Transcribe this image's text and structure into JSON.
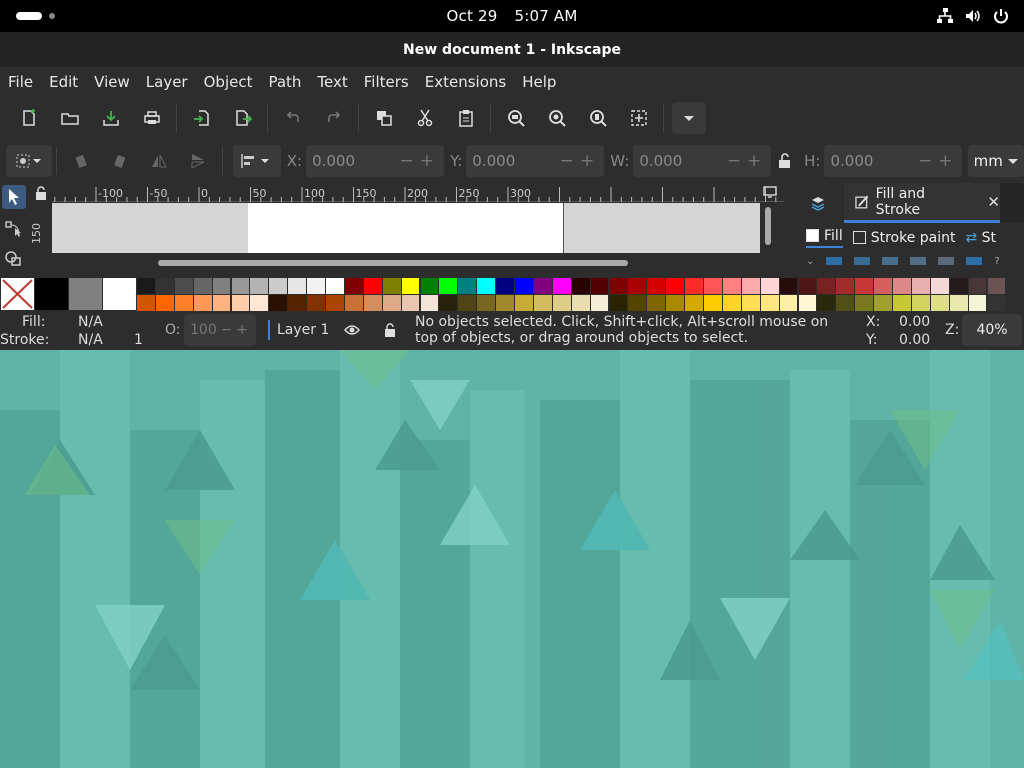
{
  "topbar": {
    "date": "Oct 29",
    "time": "5:07 AM"
  },
  "window": {
    "title": "New document 1 - Inkscape"
  },
  "menu": [
    "File",
    "Edit",
    "View",
    "Layer",
    "Object",
    "Path",
    "Text",
    "Filters",
    "Extensions",
    "Help"
  ],
  "commands": [
    "new-document-icon",
    "open-icon",
    "save-icon",
    "print-icon",
    "import-icon",
    "export-icon",
    "undo-icon",
    "redo-icon",
    "copy-icon",
    "cut-icon",
    "paste-icon",
    "zoom-selection-icon",
    "zoom-drawing-icon",
    "zoom-page-icon",
    "zoom-center-icon",
    "more-icon"
  ],
  "tool_controls": {
    "x_label": "X:",
    "x_value": "0.000",
    "y_label": "Y:",
    "y_value": "0.000",
    "w_label": "W:",
    "w_value": "0.000",
    "h_label": "H:",
    "h_value": "0.000",
    "unit": "mm"
  },
  "ruler": {
    "top_labels": [
      "-100",
      "-50",
      "0",
      "50",
      "100",
      "150",
      "200",
      "250",
      "300"
    ],
    "left_label": "150"
  },
  "dock": {
    "tab_title": "Fill and Stroke",
    "fill_tab": "Fill",
    "stroke_paint_tab": "Stroke paint",
    "stroke_style_tab": "St"
  },
  "palette": {
    "row1": [
      "#1a1a1a",
      "#333333",
      "#4d4d4d",
      "#666666",
      "#808080",
      "#999999",
      "#b3b3b3",
      "#cccccc",
      "#e6e6e6",
      "#f2f2f2",
      "#ffffff",
      "#800000",
      "#ff0000",
      "#808000",
      "#ffff00",
      "#008000",
      "#00ff00",
      "#008080",
      "#00ffff",
      "#000080",
      "#0000ff",
      "#800080",
      "#ff00ff",
      "#2b0000",
      "#550000",
      "#800000",
      "#aa0000",
      "#d40000",
      "#ff0000",
      "#ff2a2a",
      "#ff5555",
      "#ff8080",
      "#ffaaaa",
      "#ffd5d5",
      "#280b0b",
      "#501616",
      "#782121",
      "#a02c2c",
      "#c83737",
      "#d35f5f",
      "#de8787",
      "#e9afaf",
      "#f4d7d7",
      "#241c1c",
      "#483737",
      "#6c5353",
      "#917c6f",
      "#ac9393"
    ],
    "row2": [
      "#d45500",
      "#ff6600",
      "#ff7f2a",
      "#ff9955",
      "#ffb380",
      "#ffccaa",
      "#ffe6d5",
      "#2b1100",
      "#552200",
      "#803300",
      "#aa4400",
      "#c87137",
      "#d38d5f",
      "#deaa87",
      "#e9c6af",
      "#f4e3d7",
      "#28220b",
      "#504416",
      "#786721",
      "#a0892c",
      "#c8ab37",
      "#d3bc5f",
      "#decd87",
      "#e9ddaf",
      "#f4eed7",
      "#2b2200",
      "#554400",
      "#806600",
      "#aa8800",
      "#d4aa00",
      "#ffcc00",
      "#ffd42a",
      "#ffdd55",
      "#ffe680",
      "#ffeeaa",
      "#fff6d5",
      "#282a0b",
      "#505016",
      "#787821",
      "#a0a02c",
      "#c8c837",
      "#d3d35f",
      "#dede87",
      "#e9e9af",
      "#f4f4d7",
      "#333333",
      "#4d4d4d",
      "#666666",
      "#808080"
    ],
    "big": [
      "#000000",
      "#808080",
      "#ffffff"
    ]
  },
  "status": {
    "fill_label": "Fill:",
    "fill_value": "N/A",
    "stroke_label": "Stroke:",
    "stroke_value": "N/A",
    "stroke_width": "1",
    "opacity_label": "O:",
    "opacity_value": "100",
    "layer": "Layer 1",
    "message": "No objects selected. Click, Shift+click, Alt+scroll mouse on top of objects, or drag around objects to select.",
    "x_label": "X:",
    "x_value": "0.00",
    "y_label": "Y:",
    "y_value": "0.00",
    "zoom_label": "Z:",
    "zoom_value": "40%"
  }
}
